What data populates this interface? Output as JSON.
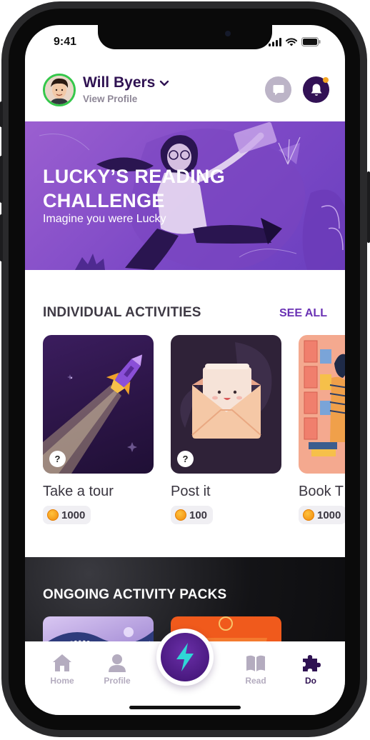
{
  "status_bar": {
    "time": "9:41"
  },
  "header": {
    "user_name": "Will Byers",
    "view_profile": "View Profile"
  },
  "banner": {
    "title": "LUCKY’S READING CHALLENGE",
    "subtitle": "Imagine you were Lucky"
  },
  "individual": {
    "section_title": "INDIVIDUAL ACTIVITIES",
    "see_all": "SEE ALL",
    "cards": [
      {
        "title": "Take a tour",
        "coins": "1000",
        "badge": "?"
      },
      {
        "title": "Post it",
        "coins": "100",
        "badge": "?"
      },
      {
        "title": "Book T",
        "coins": "1000"
      }
    ]
  },
  "packs": {
    "section_title": "ONGOING ACTIVITY PACKS"
  },
  "tabbar": {
    "tabs": [
      {
        "label": "Home",
        "icon": "home-icon"
      },
      {
        "label": "Profile",
        "icon": "person-icon"
      },
      {
        "label": "Read",
        "icon": "book-icon"
      },
      {
        "label": "Do",
        "icon": "puzzle-icon"
      }
    ],
    "active": "Do"
  },
  "colors": {
    "brand_dark": "#2f1252",
    "accent": "#6a32b4",
    "banner": "#8a52cc",
    "coin": "#f5a623",
    "online": "#35c74b"
  }
}
